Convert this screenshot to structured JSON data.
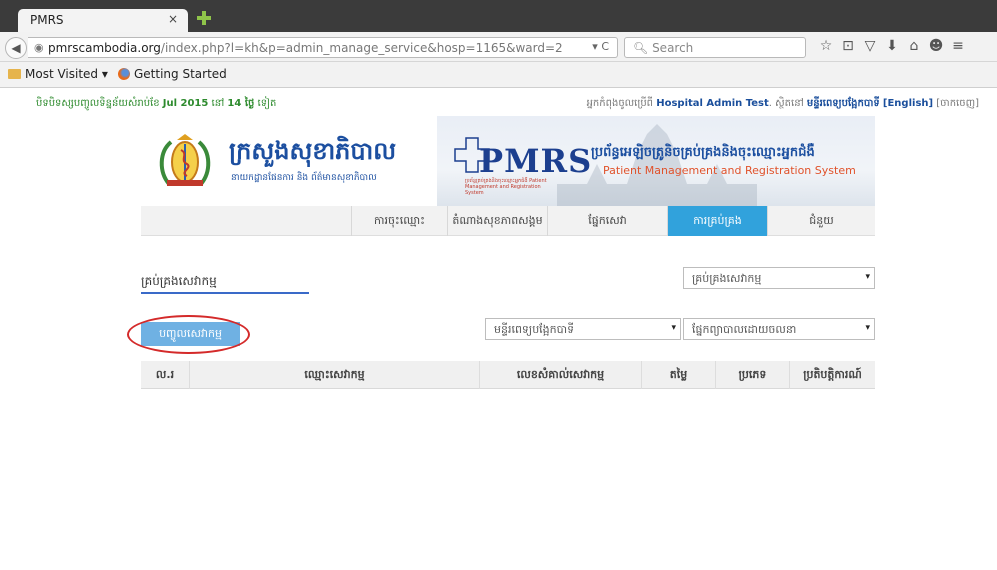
{
  "browser": {
    "tab_title": "PMRS",
    "tab_close": "×",
    "url_host": "pmrscambodia.org",
    "url_path": "/index.php?l=kh&p=admin_manage_service&hosp=1165&ward=2",
    "url_actions": "▾ C",
    "search_placeholder": "Search",
    "bookmarks": {
      "most_visited": "Most Visited ▾",
      "getting_started": "Getting Started"
    },
    "toolbar_icons": [
      "☆",
      "⊡",
      "▽",
      "⬇",
      "⌂",
      "☻",
      "≡"
    ]
  },
  "notice": {
    "prefix": "បិទបិទស្សបញ្ចូលទិន្នន័យសំរាប់ខែ ",
    "month": "Jul 2015",
    "middle": " នៅ ",
    "days": "14 ថ្ងៃ",
    "suffix": " ទៀត"
  },
  "userline": {
    "prefix": "អ្នកកំពុងចូលប្រើពី ",
    "user": "Hospital Admin Test",
    "middle": ". ស្ថិតនៅ ",
    "hospital": "មន្ទីរពេទ្យបង្អែកបាទី",
    "lang": "[English]",
    "logout": "[ចាកចេញ]"
  },
  "banner": {
    "ministry_kh": "ក្រសួងសុខាភិបាល",
    "ministry_sub": "នាយកដ្ឋានផែនការ និង ព័ត៌មានសុខាភិបាល",
    "pmrs": "PMRS",
    "pmrs_tag": "ប្រព័ន្ធគ្រប់គ្រងនិងចុះឈ្មោះអ្នកជំងឺ Patient Management and Registration System",
    "system_kh": "ប្រព័ន្ធអេឡិចត្រូនិចគ្រប់គ្រងនិងចុះឈ្មោះអ្នកជំងឺ",
    "system_en": "Patient Management and Registration System"
  },
  "menu": {
    "items": [
      {
        "label": "ការចុះឈ្មោះ",
        "active": false
      },
      {
        "label": "តំណាងសុខភាពសង្គម",
        "active": false
      },
      {
        "label": "ផ្នែកសេវា",
        "active": false
      },
      {
        "label": "ការគ្រប់គ្រង",
        "active": true
      },
      {
        "label": "ជំនួយ",
        "active": false
      }
    ]
  },
  "page": {
    "heading": "គ្រប់គ្រងសេវាកម្ម",
    "manage_select": "គ្រប់គ្រងសេវាកម្ម",
    "add_button": "បញ្ចូលសេវាកម្ម",
    "hospital_select": "មន្ទីរពេទ្យបង្អែកបាទី",
    "ward_select": "ផ្នែកព្យាបាលដោយចលនា"
  },
  "table": {
    "columns": [
      "ល.រ",
      "ឈ្មោះសេវាកម្ម",
      "លេខសំគាល់សេវាកម្ម",
      "តម្លៃ",
      "ប្រភេទ",
      "ប្រតិបត្តិការណ៍"
    ]
  },
  "colors": {
    "accent": "#31a2dc",
    "brand_blue": "#1c4fa0",
    "highlight_red": "#d42a2a",
    "notice_green": "#2e8b2e"
  }
}
